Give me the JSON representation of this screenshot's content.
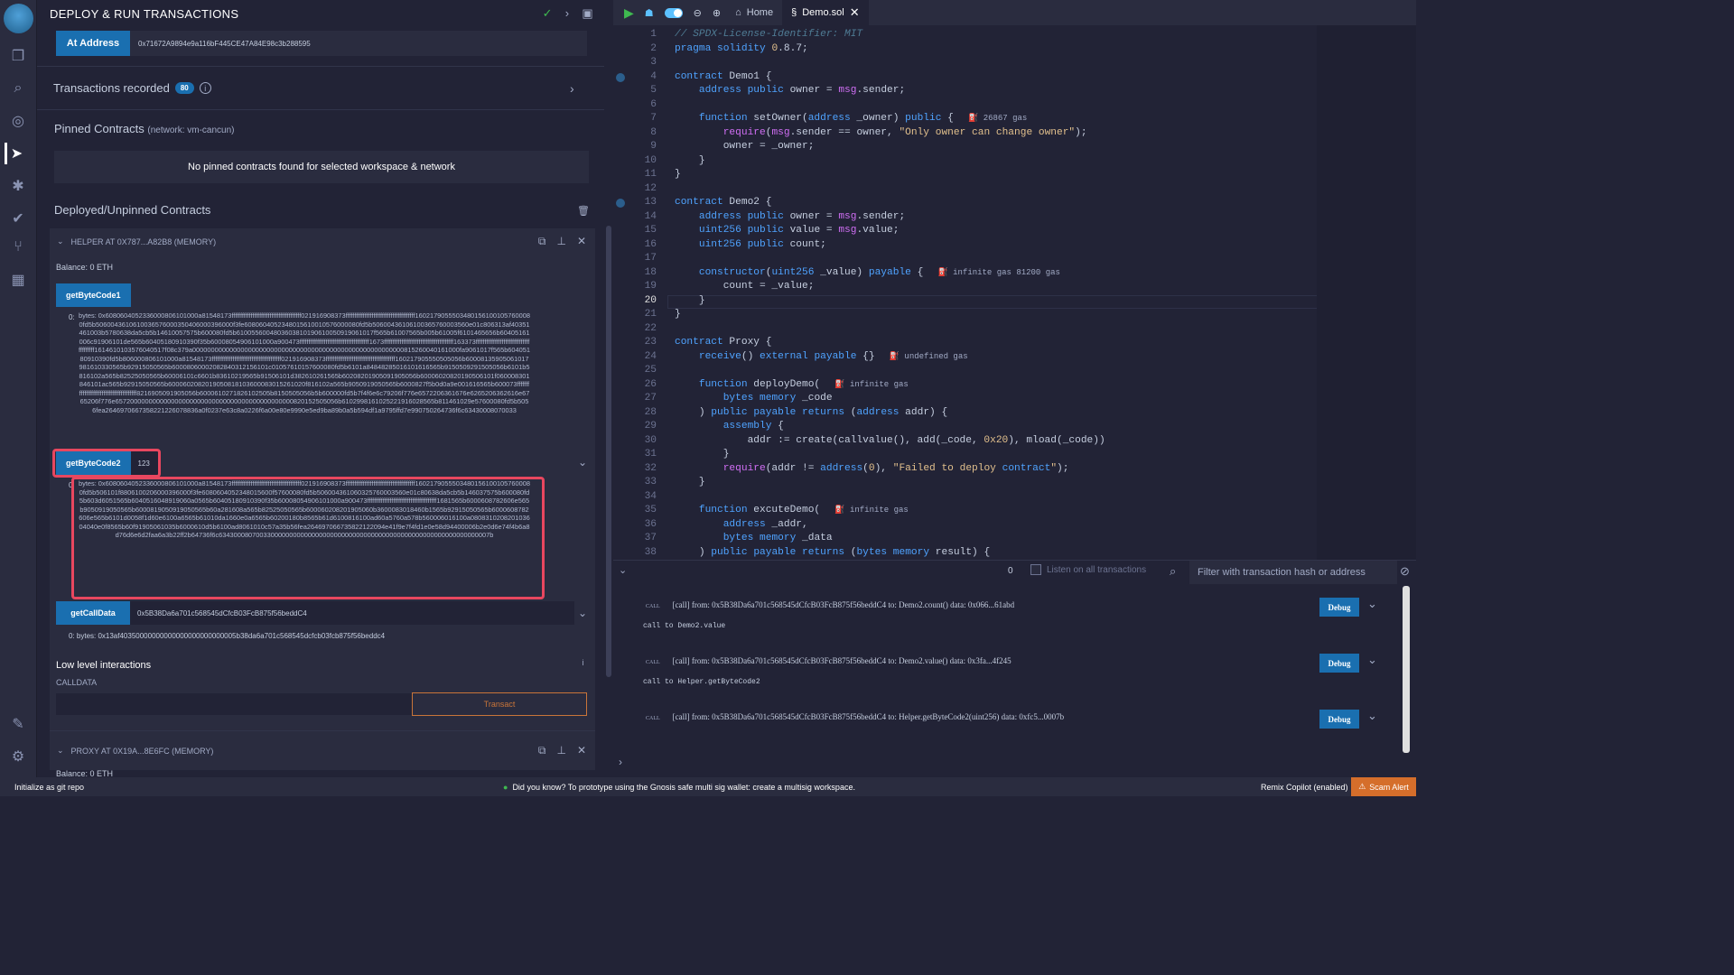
{
  "panel": {
    "title": "DEPLOY & RUN TRANSACTIONS",
    "at_address_btn": "At Address",
    "at_address_value": "0x71672A9894e9a116bF445CE47A84E98c3b288595",
    "transactions_label": "Transactions recorded",
    "transactions_count": "80",
    "pinned_title": "Pinned Contracts",
    "pinned_network": "(network: vm-cancun)",
    "no_pinned": "No pinned contracts found for selected workspace & network",
    "deployed_title": "Deployed/Unpinned Contracts"
  },
  "helper": {
    "header": "HELPER AT 0X787...A82B8 (MEMORY)",
    "balance": "Balance: 0 ETH",
    "btn1": "getByteCode1",
    "out1_prefix": "0:",
    "out1": "bytes: 0x6080604052336000806101000a81548173ffffffffffffffffffffffffffffffffffffffff021916908373ffffffffffffffffffffffffffffffffffffffff16021790555034801561001057600080fd5b5060043610610036576000350406000396000f3fe6080604052348015610010576000080fd5b50600436106100365760003560e01c806313af40351461003b5780638da5cb5b14610057575b600080fd5b6100556004803603810190610050919061017f565b61007565b005b61005f6101465656b60405161006c91906101de565b60405180910390f35b60008054906101000a900473ffffffffffffffffffffffffffffffffffffffff1673ffffffffffffffffffffffffffffffffffffffff163373ffffffffffffffffffffffffffffffffffffffff1614610103576040517f08c379a000000000000000000000000000000000000000000000000000000000815260040161000fa9061017f565b60405180910390fd5b806000806101000a81548173ffffffffffffffffffffffffffffffffffffffff021916908373ffffffffffffffffffffffffffffffffffffffff160217905550505056b60008135905061017981610330565b92915050565b60008060002082840312156101c01057610157600080fd5b6101a84848285016101616565b9150509291505056b6101b5816102a565b82525050565b60006101c6601b83610219565b91506101d382610261565b60208201905091905056b60006020820190506101f060008301846101ac565b92915050565b6000602082019050818103600083015261020f816102a565b9050919050565b6000827f5b0d0a9e001616565b600073ffffffffffffffffffffffffffffffffffffffff8216905091905056b6000610271826102505b8150505056b5b600000fd5b7f4f6e6c79206f776e6572206361676e6265206362616e6765206f776e657200000000000000000000000000000000000000000000820152505056b6102998161025221916028565b811461029e57600080fd5b5056fea2646970667358221226078836a0f0237e63c8a0226f6a00e80e9990e5ed9ba89b0a5b594df1a9795ffd7e990750264736f6c63430008070033",
    "btn2": "getByteCode2",
    "btn2_arg": "123",
    "out2_prefix": "0:",
    "out2": "bytes: 0x6080604052336000806101000a81548173ffffffffffffffffffffffffffffffffffffffff021916908373ffffffffffffffffffffffffffffffffffffffff16021790555034801561001057600080fd5b506101f8806100206000396000f3fe6080604052348015600f57600080fd5b506004361060325760003560e01c80638da5cb5b146037575b600080fd5b603d6051565b6040516048919060a0565b60405180910390f35b60008054906101000a900473ffffffffffffffffffffffffffffffffffffffff1681565b6000608782606e565b9050919050565b6000819050919050565b60a281608a565b82525050565b600060208201905060b3600083018460b1565b92915050565b6000608782606e565b6101d0058f1d60e6100a6565b61010da1660e0a6565b60200180b8565b61d6100816100ad60a5760a578b560006016100a080831020820103604040e0f8565b60f91905061035b6000610d5b6100ad8061010c57a35b56fea264697066735822122094e41f9e7f4fd1e0e58d94400006b2e0d6e74f4b6a8d76d6e6d2faa6a3b22ff2b64736f6c6343000807003300000000000000000000000000000000000000000000000000000000007b",
    "btn3": "getCallData",
    "btn3_arg": "0x5B38Da6a701c568545dCfcB03FcB875f56beddC4",
    "out3": "0: bytes: 0x13af40350000000000000000000000005b38da6a701c568545dcfcb03fcb875f56beddc4",
    "lli_title": "Low level interactions",
    "calldata_label": "CALLDATA",
    "transact": "Transact"
  },
  "proxy": {
    "header": "PROXY AT 0X19A...8E6FC (MEMORY)",
    "balance": "Balance: 0 ETH"
  },
  "editor": {
    "tabs": {
      "home": "Home",
      "file": "Demo.sol"
    },
    "lines": [
      "// SPDX-License-Identifier: MIT",
      "pragma solidity 0.8.7;",
      "",
      "contract Demo1 {",
      "    address public owner = msg.sender;",
      "",
      "    function setOwner(address _owner) public {",
      "        require(msg.sender == owner, \"Only owner can change owner\");",
      "        owner = _owner;",
      "    }",
      "}",
      "",
      "contract Demo2 {",
      "    address public owner = msg.sender;",
      "    uint256 public value = msg.value;",
      "    uint256 public count;",
      "",
      "    constructor(uint256 _value) payable {",
      "        count = _value;",
      "    }",
      "}",
      "",
      "contract Proxy {",
      "    receive() external payable {}",
      "",
      "    function deployDemo(",
      "        bytes memory _code",
      "    ) public payable returns (address addr) {",
      "        assembly {",
      "            addr := create(callvalue(), add(_code, 0x20), mload(_code))",
      "        }",
      "        require(addr != address(0), \"Failed to deploy contract\");",
      "    }",
      "",
      "    function excuteDemo(",
      "        address _addr,",
      "        bytes memory _data",
      "    ) public payable returns (bytes memory result) {"
    ],
    "gas_hints": {
      "7": "26867 gas",
      "18": "infinite gas 81200 gas",
      "24": "undefined gas",
      "26": "infinite gas",
      "35": "infinite gas"
    },
    "current_line": "20"
  },
  "terminal": {
    "count": "0",
    "listen_label": "Listen on all transactions",
    "filter_placeholder": "Filter with transaction hash or address",
    "logs": [
      {
        "tag": "CALL",
        "text": "[call] from: 0x5B38Da6a701c568545dCfcB03FcB875f56beddC4 to: Demo2.count() data: 0x066...61abd",
        "sub": "call to Demo2.value"
      },
      {
        "tag": "CALL",
        "text": "[call] from: 0x5B38Da6a701c568545dCfcB03FcB875f56beddC4 to: Demo2.value() data: 0x3fa...4f245",
        "sub": "call to Helper.getByteCode2"
      },
      {
        "tag": "CALL",
        "text": "[call] from: 0x5B38Da6a701c568545dCfcB03FcB875f56beddC4 to: Helper.getByteCode2(uint256) data: 0xfc5...0007b",
        "sub": ""
      }
    ],
    "debug_label": "Debug"
  },
  "status": {
    "git": "Initialize as git repo",
    "tip": "Did you know?   To prototype using the Gnosis safe multi sig wallet: create a multisig workspace.",
    "copilot": "Remix Copilot (enabled)",
    "scam": "Scam Alert"
  }
}
